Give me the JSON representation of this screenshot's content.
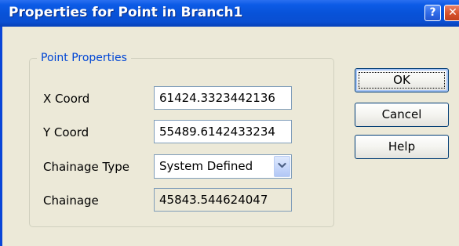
{
  "window": {
    "title": "Properties for Point in Branch1",
    "help_glyph": "?",
    "close_glyph": "✕"
  },
  "group": {
    "legend": "Point Properties"
  },
  "fields": {
    "x_coord_label": "X Coord",
    "x_coord_value": "61424.3323442136",
    "y_coord_label": "Y Coord",
    "y_coord_value": "55489.6142433234",
    "chainage_type_label": "Chainage Type",
    "chainage_type_value": "System Defined",
    "chainage_label": "Chainage",
    "chainage_value": "45843.544624047"
  },
  "buttons": {
    "ok": "OK",
    "cancel": "Cancel",
    "help": "Help"
  },
  "colors": {
    "titlebar": "#0852d8",
    "dialog_bg": "#ece9d8",
    "group_legend": "#0046d5",
    "close_button": "#d9552e"
  }
}
